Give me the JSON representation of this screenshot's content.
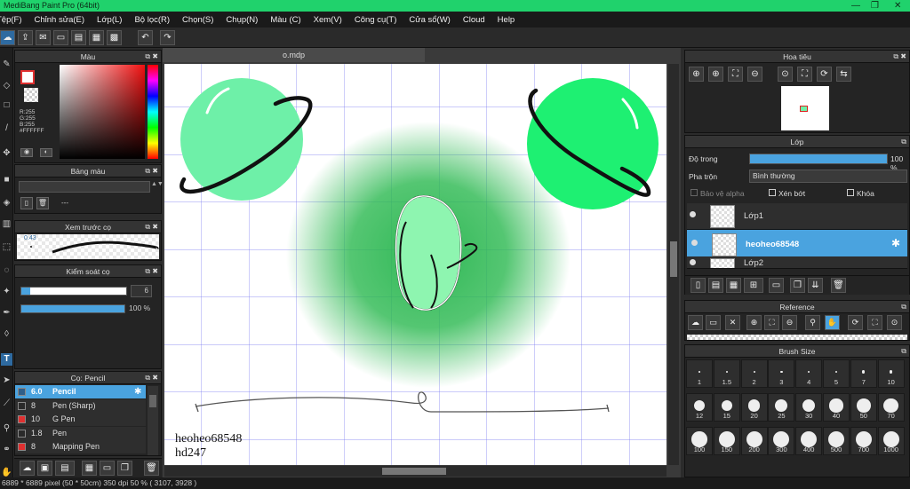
{
  "title_bar": {
    "title": "MediBang Paint Pro (64bit)"
  },
  "menu": [
    "Tệp(F)",
    "Chỉnh sửa(E)",
    "Lớp(L)",
    "Bộ lọc(R)",
    "Chọn(S)",
    "Chụp(N)",
    "Màu (C)",
    "Xem(V)",
    "Công cụ(T)",
    "Cửa sổ(W)",
    "Cloud",
    "Help"
  ],
  "color_panel": {
    "title": "Màu",
    "r": "R:255",
    "g": "G:255",
    "b": "B:255",
    "hex": "#FFFFFF"
  },
  "palette_panel": {
    "title": "Bảng màu",
    "value": "---"
  },
  "brush_preview": {
    "title": "Xem trước cọ",
    "size_text": "0.43"
  },
  "brush_control": {
    "title": "Kiểm soát cọ",
    "size_value": "6",
    "opacity_value": "100 %",
    "opacity_fraction": 1.0
  },
  "brush_list": {
    "title": "Cọ: Pencil",
    "items": [
      {
        "size": "6.0",
        "name": "Pencil",
        "color": "#2f5f8a",
        "selected": true
      },
      {
        "size": "8",
        "name": "Pen (Sharp)",
        "color": "#2a2a2a",
        "selected": false
      },
      {
        "size": "10",
        "name": "G Pen",
        "color": "#e03030",
        "selected": false
      },
      {
        "size": "1.8",
        "name": "Pen",
        "color": "#2a2a2a",
        "selected": false
      },
      {
        "size": "8",
        "name": "Mapping Pen",
        "color": "#e03030",
        "selected": false
      }
    ]
  },
  "document": {
    "tab": "o.mdp",
    "text_line1": "heoheo68548",
    "text_line2": "hd247"
  },
  "navigator": {
    "title": "Hoa tiêu"
  },
  "layer_panel": {
    "title": "Lớp",
    "opacity_label": "Độ trong",
    "opacity_value": "100 %",
    "opacity_fraction": 1.0,
    "blend_label": "Pha trộn",
    "blend_value": "Bình thường",
    "protect_alpha": "Bảo vệ alpha",
    "clipping": "Xén bớt",
    "lock": "Khóa",
    "layers": [
      {
        "name": "Lớp1",
        "selected": false
      },
      {
        "name": "heoheo68548",
        "selected": true
      },
      {
        "name": "Lớp2",
        "selected": false
      }
    ]
  },
  "reference_panel": {
    "title": "Reference"
  },
  "brush_size_panel": {
    "title": "Brush Size",
    "sizes": [
      "1",
      "1.5",
      "2",
      "3",
      "4",
      "5",
      "7",
      "10",
      "12",
      "15",
      "20",
      "25",
      "30",
      "40",
      "50",
      "70",
      "100",
      "150",
      "200",
      "300",
      "400",
      "500",
      "700",
      "1000"
    ]
  },
  "status_bar": {
    "text": "6889 * 6889 pixel  (50 * 50cm)  350 dpi  50 %  ( 3107, 3928 )"
  },
  "colors": {
    "accent": "#4aa3df",
    "title_green": "#20d26c",
    "planet_light": "#6ef0a8",
    "planet_bright": "#1ef072",
    "blur_green": "#23b34c"
  }
}
